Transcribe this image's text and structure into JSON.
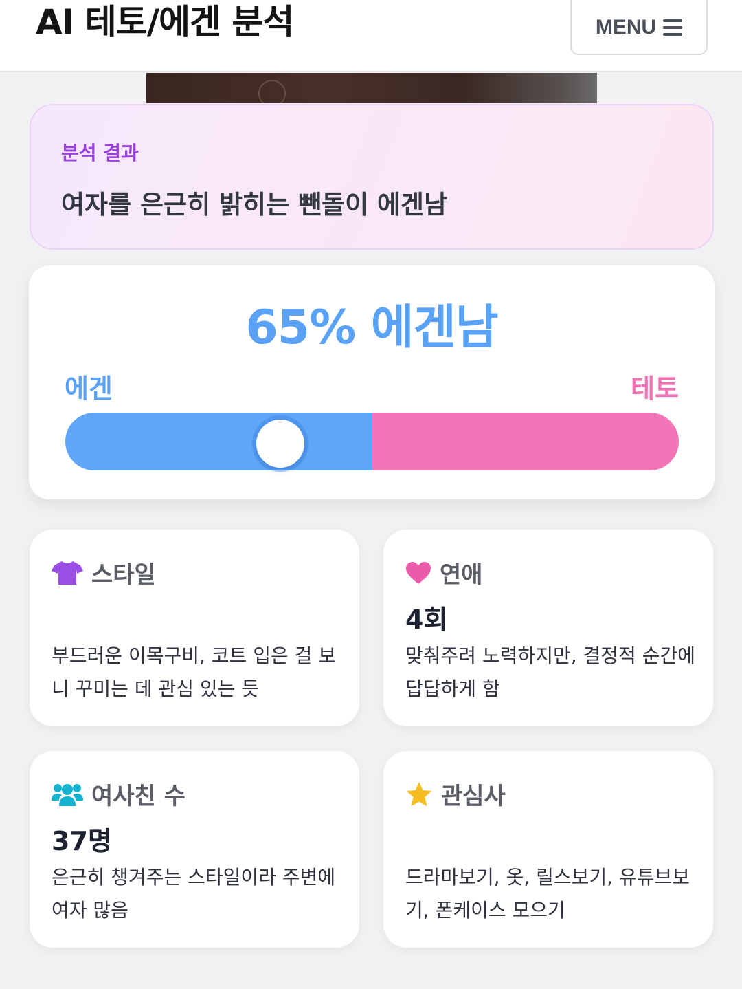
{
  "header": {
    "title": "AI 테토/에겐 분석",
    "menu_label": "MENU"
  },
  "result": {
    "label": "분석 결과",
    "text": "여자를 은근히 밝히는 뺀돌이 에겐남"
  },
  "score": {
    "headline": "65% 에겐남",
    "left_label": "에겐",
    "right_label": "테토",
    "egen_percent": 65
  },
  "cards": {
    "style": {
      "title": "스타일",
      "value": "",
      "desc": "부드러운 이목구비, 코트 입은 걸 보니 꾸미는 데 관심 있는 듯",
      "icon": "shirt-icon"
    },
    "love": {
      "title": "연애",
      "value": "4회",
      "desc": "맞춰주려 노력하지만, 결정적 순간에 답답하게 함",
      "icon": "heart-icon"
    },
    "friends": {
      "title": "여사친 수",
      "value": "37명",
      "desc": "은근히 챙겨주는 스타일이라 주변에 여자 많음",
      "icon": "users-icon"
    },
    "hobby": {
      "title": "관심사",
      "value": "",
      "desc": "드라마보기, 옷, 릴스보기, 유튜브보기, 폰케이스 모으기",
      "icon": "star-icon"
    }
  },
  "colors": {
    "egen": "#5ea6f6",
    "teto": "#f275b8",
    "accent_purple": "#9a3fe0"
  }
}
